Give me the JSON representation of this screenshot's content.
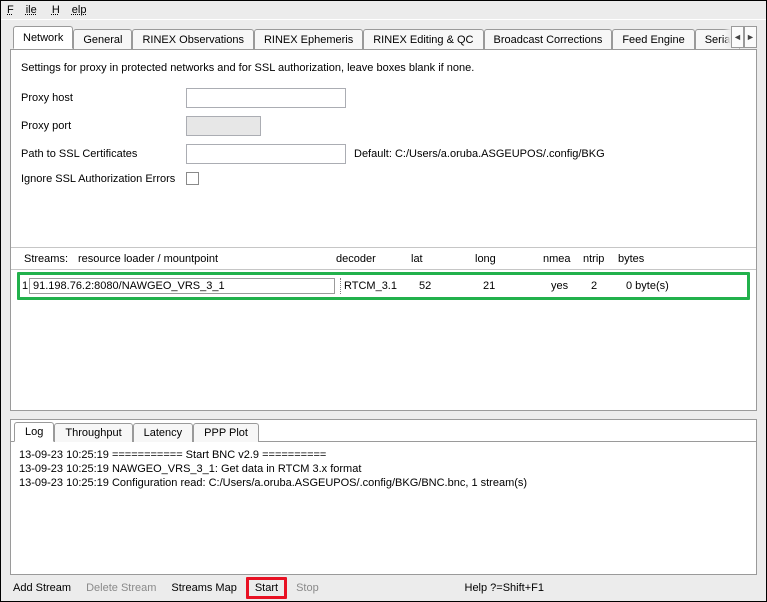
{
  "menu": {
    "file": "File",
    "help": "Help"
  },
  "tabs": [
    {
      "label": "Network"
    },
    {
      "label": "General"
    },
    {
      "label": "RINEX Observations"
    },
    {
      "label": "RINEX Ephemeris"
    },
    {
      "label": "RINEX Editing & QC"
    },
    {
      "label": "Broadcast Corrections"
    },
    {
      "label": "Feed Engine"
    },
    {
      "label": "Seria"
    }
  ],
  "settings": {
    "description": "Settings for proxy in protected networks and for SSL authorization, leave boxes blank if none.",
    "proxy_host_label": "Proxy host",
    "proxy_port_label": "Proxy port",
    "ssl_path_label": "Path to SSL Certificates",
    "default_prefix": "Default:  ",
    "default_path": "C:/Users/a.oruba.ASGEUPOS/.config/BKG",
    "ignore_ssl_label": "Ignore SSL Authorization Errors"
  },
  "streams": {
    "header_prefix": "Streams:",
    "columns": {
      "mountpoint": "resource loader / mountpoint",
      "decoder": "decoder",
      "lat": "lat",
      "long": "long",
      "nmea": "nmea",
      "ntrip": "ntrip",
      "bytes": "bytes"
    },
    "rows": [
      {
        "idx": "1",
        "mountpoint": "91.198.76.2:8080/NAWGEO_VRS_3_1",
        "decoder": "RTCM_3.1",
        "lat": "52",
        "long": "21",
        "nmea": "yes",
        "ntrip": "2",
        "bytes": "0 byte(s)"
      }
    ]
  },
  "log_tabs": [
    {
      "label": "Log"
    },
    {
      "label": "Throughput"
    },
    {
      "label": "Latency"
    },
    {
      "label": "PPP Plot"
    }
  ],
  "log_lines": [
    "13-09-23 10:25:19 =========== Start BNC v2.9 ==========",
    "13-09-23 10:25:19 NAWGEO_VRS_3_1: Get data in RTCM 3.x format",
    "13-09-23 10:25:19 Configuration read: C:/Users/a.oruba.ASGEUPOS/.config/BKG/BNC.bnc, 1 stream(s)"
  ],
  "toolbar": {
    "add_stream": "Add Stream",
    "delete_stream": "Delete Stream",
    "streams_map": "Streams Map",
    "start": "Start",
    "stop": "Stop",
    "help_hint": "Help ?=Shift+F1"
  }
}
